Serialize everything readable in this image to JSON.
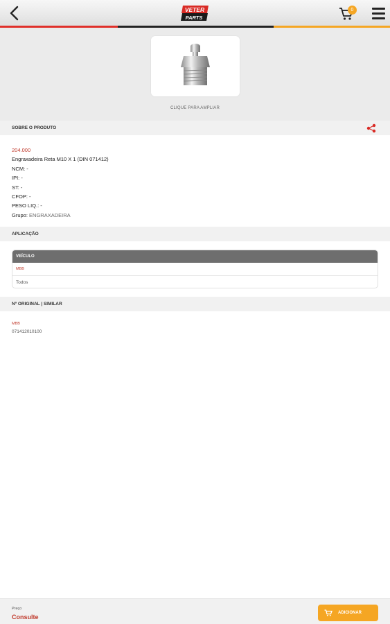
{
  "header": {
    "logo_top": "VETER",
    "logo_bottom": "PARTS",
    "cart_count": "0"
  },
  "image_panel": {
    "enlarge_label": "CLIQUE PARA AMPLIAR"
  },
  "about": {
    "title": "SOBRE O PRODUTO",
    "code": "204.000",
    "name": "Engraxadeira Reta M10 X 1 (DIN 071412)",
    "ncm": "NCM: -",
    "ipi": "IPI: -",
    "st": "ST: -",
    "cfop": "CFOP: -",
    "weight": "PESO LIQ.: -",
    "group_label": "Grupo:",
    "group_value": "ENGRAXADEIRA"
  },
  "application": {
    "title": "APLICAÇÃO",
    "column_header": "VEÍCULO",
    "brand": "MBB",
    "vehicle": "Todos"
  },
  "original": {
    "title": "Nº ORIGINAL | SIMILAR",
    "brand": "MBB",
    "number": "071412010100"
  },
  "footer": {
    "price_label": "Preço",
    "price_value": "Consulte",
    "add_label": "ADICIONAR"
  },
  "colors": {
    "accent_orange": "#f5a623",
    "accent_red": "#e0302a",
    "text_red": "#c0392b"
  }
}
